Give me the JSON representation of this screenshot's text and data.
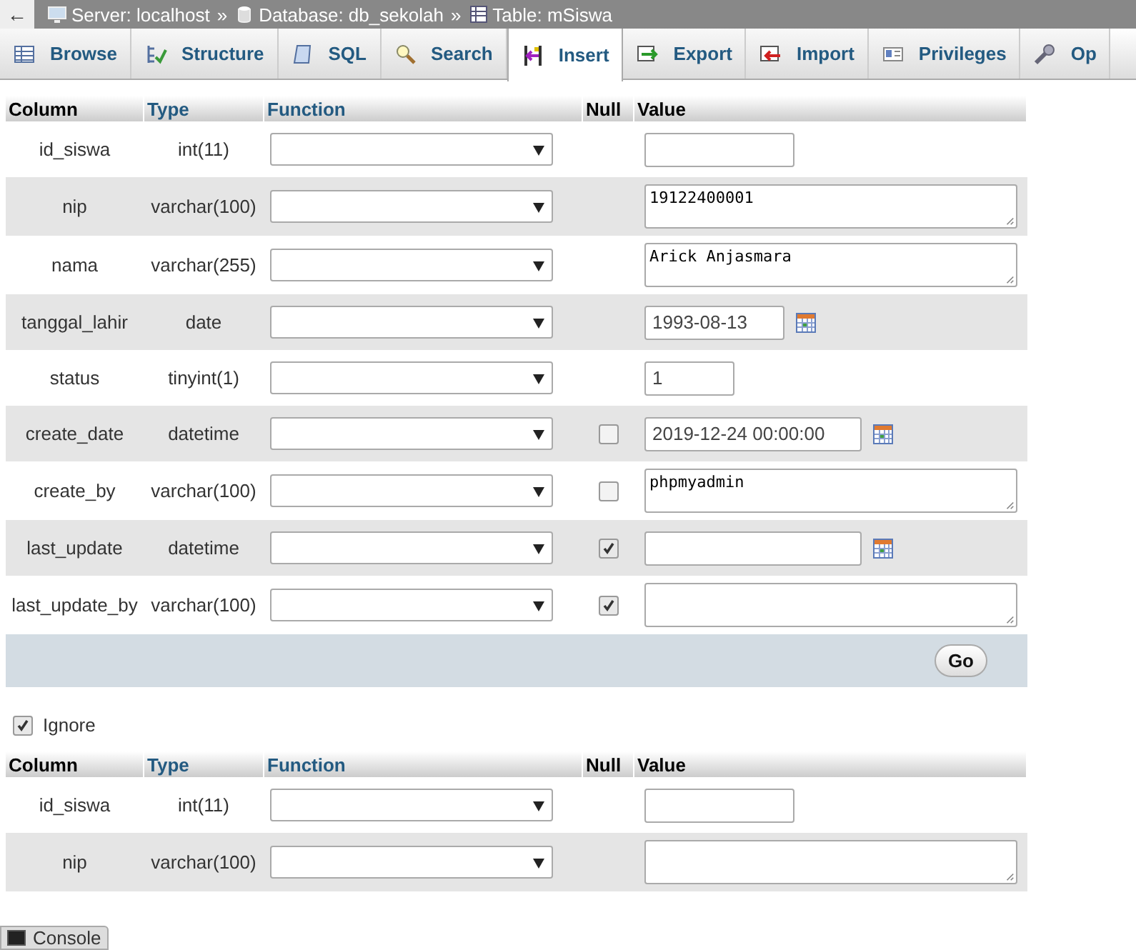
{
  "breadcrumb": [
    {
      "kind": "server",
      "label": "Server: localhost"
    },
    {
      "kind": "database",
      "label": "Database: db_sekolah"
    },
    {
      "kind": "table",
      "label": "Table: mSiswa"
    }
  ],
  "breadcrumb_separator": "»",
  "back_arrow": "←",
  "tabs": [
    {
      "kind": "browse",
      "label": "Browse",
      "selected": false
    },
    {
      "kind": "structure",
      "label": "Structure",
      "selected": false
    },
    {
      "kind": "sql",
      "label": "SQL",
      "selected": false
    },
    {
      "kind": "search",
      "label": "Search",
      "selected": false
    },
    {
      "kind": "insert",
      "label": "Insert",
      "selected": true
    },
    {
      "kind": "export",
      "label": "Export",
      "selected": false
    },
    {
      "kind": "import",
      "label": "Import",
      "selected": false
    },
    {
      "kind": "privileges",
      "label": "Privileges",
      "selected": false
    },
    {
      "kind": "operations",
      "label": "Op",
      "selected": false
    }
  ],
  "forms": [
    {
      "headers": {
        "column": "Column",
        "type": "Type",
        "function": "Function",
        "null": "Null",
        "value": "Value"
      },
      "rows": [
        {
          "column": "id_siswa",
          "type": "int(11)",
          "kind": "int",
          "value": ""
        },
        {
          "column": "nip",
          "type": "varchar(100)",
          "kind": "textarea",
          "value": "19122400001"
        },
        {
          "column": "nama",
          "type": "varchar(255)",
          "kind": "textarea",
          "value": "Arick Anjasmara"
        },
        {
          "column": "tanggal_lahir",
          "type": "date",
          "kind": "date",
          "value": "1993-08-13"
        },
        {
          "column": "status",
          "type": "tinyint(1)",
          "kind": "tiny",
          "value": "1"
        },
        {
          "column": "create_date",
          "type": "datetime",
          "kind": "datetime",
          "value": "2019-12-24 00:00:00",
          "nullable": true,
          "checked": false
        },
        {
          "column": "create_by",
          "type": "varchar(100)",
          "kind": "textarea",
          "value": "phpmyadmin",
          "nullable": true,
          "checked": false
        },
        {
          "column": "last_update",
          "type": "datetime",
          "kind": "datetime",
          "value": "",
          "nullable": true,
          "checked": true
        },
        {
          "column": "last_update_by",
          "type": "varchar(100)",
          "kind": "textarea",
          "value": "",
          "nullable": true,
          "checked": true
        }
      ],
      "go_button": "Go",
      "ignore": {
        "label": "Ignore",
        "checked": true
      }
    },
    {
      "headers": {
        "column": "Column",
        "type": "Type",
        "function": "Function",
        "null": "Null",
        "value": "Value"
      },
      "rows": [
        {
          "column": "id_siswa",
          "type": "int(11)",
          "kind": "int",
          "value": ""
        },
        {
          "column": "nip",
          "type": "varchar(100)",
          "kind": "textarea",
          "value": ""
        }
      ]
    }
  ],
  "console": "Console"
}
